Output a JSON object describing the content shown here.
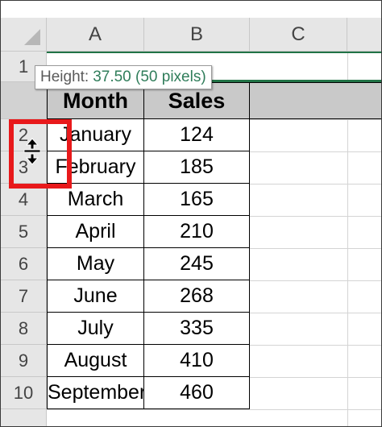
{
  "columns": [
    "A",
    "B",
    "C"
  ],
  "row_numbers": [
    "1",
    "2",
    "3",
    "4",
    "5",
    "6",
    "7",
    "8",
    "9",
    "10"
  ],
  "tooltip": {
    "label": "Height:",
    "value": "37.50 (50 pixels)"
  },
  "table": {
    "headers": [
      "Month",
      "Sales"
    ],
    "rows": [
      [
        "January",
        "124"
      ],
      [
        "February",
        "185"
      ],
      [
        "March",
        "165"
      ],
      [
        "April",
        "210"
      ],
      [
        "May",
        "245"
      ],
      [
        "June",
        "268"
      ],
      [
        "July",
        "335"
      ],
      [
        "August",
        "410"
      ],
      [
        "September",
        "460"
      ]
    ]
  },
  "colors": {
    "selection": "#217346",
    "header_fill": "#c9c9c9",
    "highlight": "#e8191b"
  },
  "icons": {
    "cursor": "row-resize-cursor-icon"
  }
}
